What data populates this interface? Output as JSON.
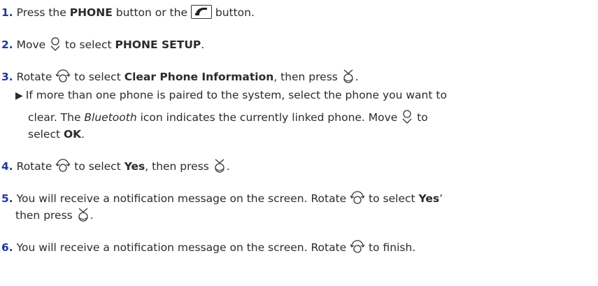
{
  "steps": [
    {
      "num": "1.",
      "t1": "Press the ",
      "b1": "PHONE",
      "t2": " button or the ",
      "t3": " button."
    },
    {
      "num": "2.",
      "t1": "Move ",
      "t2": " to select ",
      "b1": "PHONE SETUP",
      "t3": "."
    },
    {
      "num": "3.",
      "t1": "Rotate ",
      "t2": " to select ",
      "b1": "Clear Phone Information",
      "t3": ", then press ",
      "t4": "."
    },
    {
      "num": "4.",
      "t1": "Rotate ",
      "t2": " to select ",
      "b1": "Yes",
      "t3": ", then press ",
      "t4": "."
    },
    {
      "num": "5.",
      "line1": "You will receive a notification message on the screen. Rotate ",
      "line1b": " to select ",
      "b1": "Yes",
      "line1c": "’",
      "line2": "then press ",
      "line2b": "."
    },
    {
      "num": "6.",
      "t1": "You will receive a notification message on the screen. Rotate ",
      "t2": " to finish."
    }
  ],
  "note": {
    "line1": "If more than one phone is paired to the system, select the phone you want to",
    "line2a": "clear. The ",
    "italic": "Bluetooth",
    "line2b": " icon indicates the currently linked phone. Move ",
    "line2c": " to",
    "line3a": "select ",
    "bold": "OK",
    "line3b": "."
  },
  "icons": {
    "phone_button": "phone-handset-icon",
    "move": "move-down-joystick-icon",
    "rotate": "rotate-dial-icon",
    "press": "press-knob-icon"
  },
  "colors": {
    "step_number": "#1f3a9a",
    "text": "#2b2b2b"
  }
}
